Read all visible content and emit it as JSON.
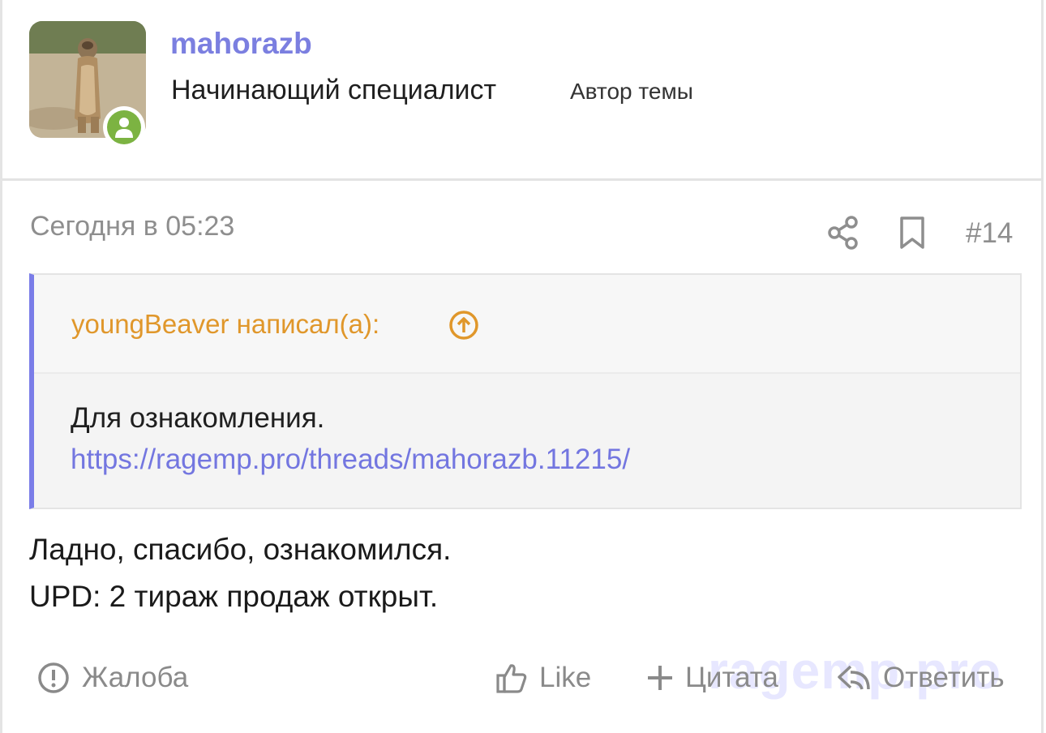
{
  "user": {
    "name": "mahorazb",
    "title": "Начинающий специалист",
    "badge": "Автор темы",
    "status_color": "#7cb342"
  },
  "post": {
    "date": "Сегодня в 05:23",
    "number": "#14",
    "icons": [
      "share-icon",
      "bookmark-icon"
    ]
  },
  "quote": {
    "author": "youngBeaver написал(а):",
    "text": "Для ознакомления.",
    "link": "https://ragemp.pro/threads/mahorazb.11215/",
    "accent_color": "#7a7de8",
    "author_color": "#e0972b"
  },
  "message": {
    "lines": [
      "Ладно, спасибо, ознакомился.",
      "UPD: 2 тираж продаж открыт."
    ]
  },
  "actions": {
    "report": "Жалоба",
    "like": "Like",
    "quote": "Цитата",
    "reply": "Ответить"
  },
  "watermark": "ragemp.pro",
  "colors": {
    "username": "#7b7fe0",
    "link": "#7376e0",
    "muted": "#8e8e8e"
  }
}
